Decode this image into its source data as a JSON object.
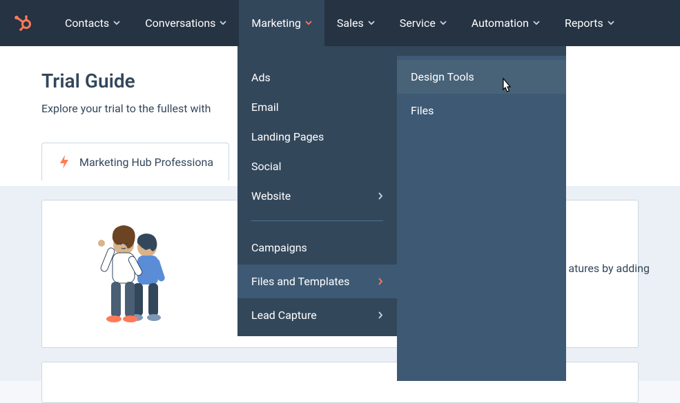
{
  "nav": {
    "items": [
      {
        "label": "Contacts",
        "has_caret": true,
        "active": false
      },
      {
        "label": "Conversations",
        "has_caret": true,
        "active": false
      },
      {
        "label": "Marketing",
        "has_caret": true,
        "active": true
      },
      {
        "label": "Sales",
        "has_caret": true,
        "active": false
      },
      {
        "label": "Service",
        "has_caret": true,
        "active": false
      },
      {
        "label": "Automation",
        "has_caret": true,
        "active": false
      },
      {
        "label": "Reports",
        "has_caret": true,
        "active": false
      }
    ]
  },
  "page": {
    "title": "Trial Guide",
    "subtitle_visible": "Explore your trial to the fullest with",
    "tab_label": "Marketing Hub Professiona",
    "card_text_fragment": "atures by adding"
  },
  "dropdown": {
    "col1": [
      {
        "label": "Ads",
        "has_chevron": false,
        "active": false
      },
      {
        "label": "Email",
        "has_chevron": false,
        "active": false
      },
      {
        "label": "Landing Pages",
        "has_chevron": false,
        "active": false
      },
      {
        "label": "Social",
        "has_chevron": false,
        "active": false
      },
      {
        "label": "Website",
        "has_chevron": true,
        "active": false
      }
    ],
    "col1b": [
      {
        "label": "Campaigns",
        "has_chevron": false,
        "active": false
      },
      {
        "label": "Files and Templates",
        "has_chevron": true,
        "active": true
      },
      {
        "label": "Lead Capture",
        "has_chevron": true,
        "active": false
      }
    ],
    "col2": [
      {
        "label": "Design Tools",
        "hovered": true
      },
      {
        "label": "Files",
        "hovered": false
      }
    ]
  },
  "colors": {
    "brand_orange": "#ff7a59",
    "nav_bg": "#253342",
    "dropdown_bg": "#33475b",
    "submenu_bg": "#3e5974"
  }
}
